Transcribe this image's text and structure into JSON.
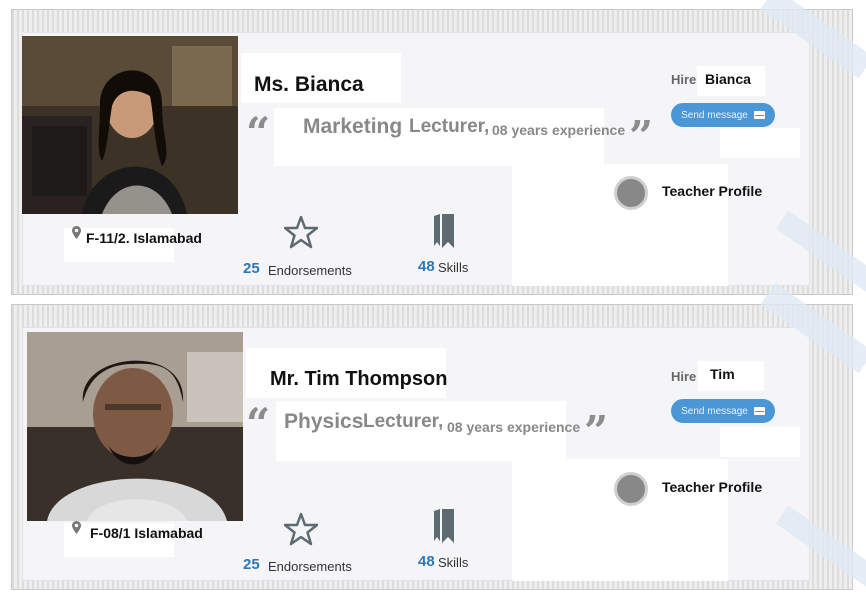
{
  "teachers": [
    {
      "name": "Ms. Bianca",
      "subject": "Marketing",
      "title": "Lecturer,",
      "experience": "08 years experience",
      "hire_label": "Hire",
      "hire_name": "Bianca",
      "send_message": "Send message",
      "profile_link": "Teacher Profile",
      "location": "F-11/2. Islamabad",
      "endorsements_count": "25",
      "endorsements_label": "Endorsements",
      "skills_count": "48",
      "skills_label": "Skills",
      "open_quote": "“",
      "close_quote": "”"
    },
    {
      "name": "Mr. Tim Thompson",
      "subject": "Physics",
      "title": "Lecturer,",
      "experience": "08 years experience",
      "hire_label": "Hire",
      "hire_name": "Tim",
      "send_message": "Send message",
      "profile_link": "Teacher Profile",
      "location": "F-08/1 Islamabad",
      "endorsements_count": "25",
      "endorsements_label": "Endorsements",
      "skills_count": "48",
      "skills_label": "Skills",
      "open_quote": "“",
      "close_quote": "”"
    }
  ],
  "icons": {
    "location": "map-pin-icon",
    "endorsements": "star-icon",
    "skills": "bookmark-icon",
    "send": "envelope-icon",
    "profile": "profile-dot-icon"
  },
  "colors": {
    "accent": "#2e78b7",
    "button": "#4a96d6",
    "muted_text": "#888888"
  }
}
